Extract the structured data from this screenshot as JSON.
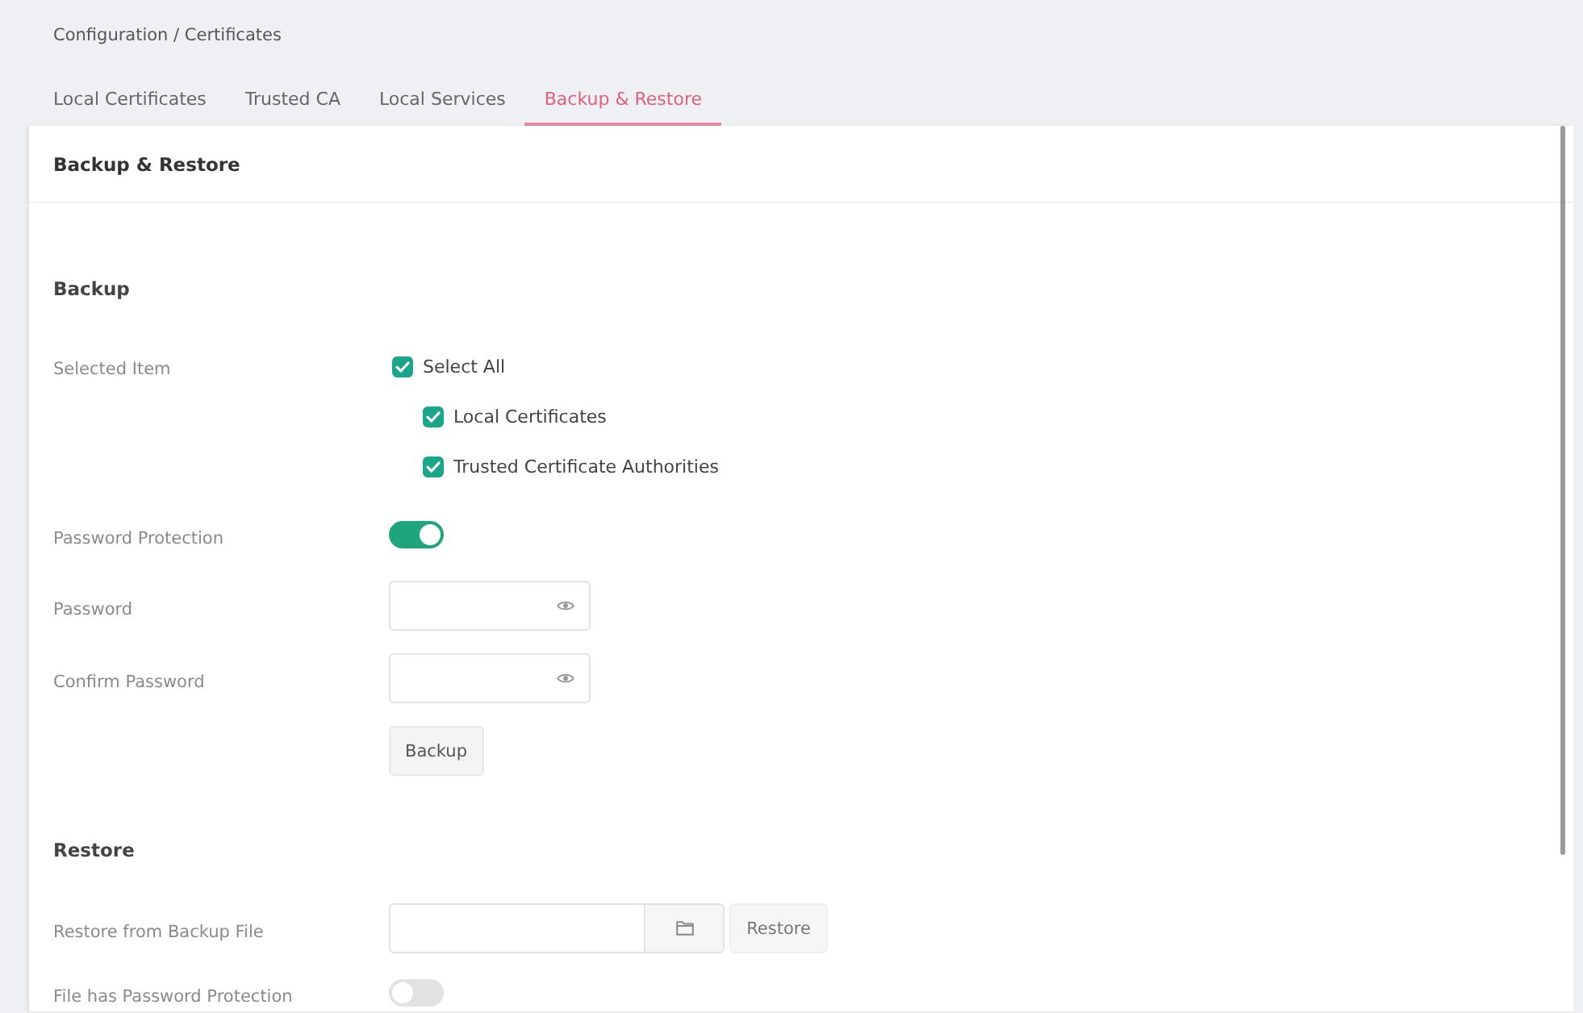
{
  "breadcrumb": "Configuration / Certificates",
  "tabs": [
    {
      "label": "Local Certificates",
      "selected": false
    },
    {
      "label": "Trusted CA",
      "selected": false
    },
    {
      "label": "Local Services",
      "selected": false
    },
    {
      "label": "Backup & Restore",
      "selected": true
    }
  ],
  "panel": {
    "title": "Backup & Restore",
    "sections": [
      {
        "title": "Backup",
        "rows": [
          {
            "kind": "checklist",
            "label": "Selected Item",
            "options": [
              {
                "label": "Select All",
                "checked": true,
                "children": [
                  {
                    "label": "Local Certificates",
                    "checked": true
                  },
                  {
                    "label": "Trusted Certificate Authorities",
                    "checked": true
                  }
                ]
              }
            ]
          },
          {
            "kind": "toggle",
            "label": "Password Protection",
            "on": true
          },
          {
            "kind": "password",
            "label": "Password"
          },
          {
            "kind": "password",
            "label": "Confirm Password"
          },
          {
            "kind": "button",
            "button": "Backup"
          }
        ]
      },
      {
        "title": "Restore",
        "rows": [
          {
            "kind": "file",
            "label": "Restore from Backup File",
            "button": "Restore"
          },
          {
            "kind": "toggle",
            "label": "File has Password Protection",
            "on": false
          }
        ]
      }
    ]
  }
}
